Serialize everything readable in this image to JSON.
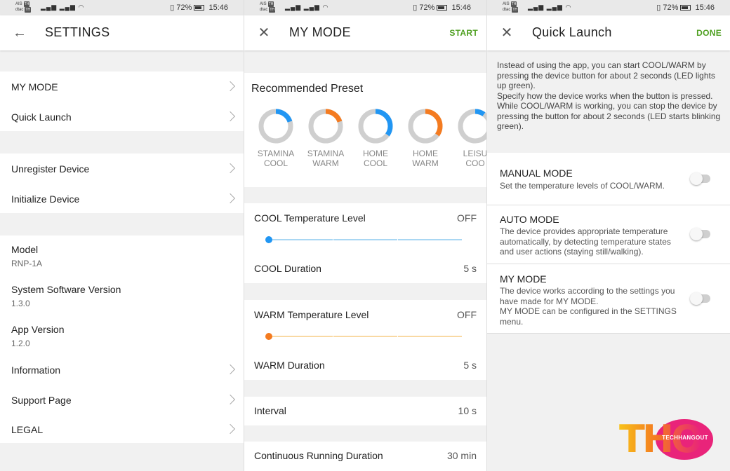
{
  "status_bar": {
    "carrier_1": "AIS",
    "carrier_2": "dtac",
    "carrier_tag": "TH",
    "battery": "72%",
    "time": "15:46"
  },
  "settings": {
    "title": "SETTINGS",
    "items": {
      "my_mode": "MY MODE",
      "quick_launch": "Quick Launch",
      "unregister": "Unregister Device",
      "initialize": "Initialize Device",
      "model_label": "Model",
      "model_value": "RNP-1A",
      "sw_label": "System Software Version",
      "sw_value": "1.3.0",
      "app_label": "App Version",
      "app_value": "1.2.0",
      "information": "Information",
      "support": "Support Page",
      "legal": "LEGAL"
    }
  },
  "my_mode": {
    "title": "MY MODE",
    "start_label": "START",
    "preset_heading": "Recommended Preset",
    "presets": [
      {
        "line1": "STAMINA",
        "line2": "COOL",
        "color": "#2196f3",
        "level": 0.2
      },
      {
        "line1": "STAMINA",
        "line2": "WARM",
        "color": "#f47b20",
        "level": 0.2
      },
      {
        "line1": "HOME",
        "line2": "COOL",
        "color": "#2196f3",
        "level": 0.35
      },
      {
        "line1": "HOME",
        "line2": "WARM",
        "color": "#f47b20",
        "level": 0.35
      },
      {
        "line1": "LEISU",
        "line2": "COO",
        "color": "#2196f3",
        "level": 0.1
      }
    ],
    "cool_level_label": "COOL Temperature Level",
    "cool_level_value": "OFF",
    "cool_duration_label": "COOL Duration",
    "cool_duration_value": "5 s",
    "warm_level_label": "WARM Temperature Level",
    "warm_level_value": "OFF",
    "warm_duration_label": "WARM Duration",
    "warm_duration_value": "5 s",
    "interval_label": "Interval",
    "interval_value": "10 s",
    "continuous_label": "Continuous Running Duration",
    "continuous_value": "30 min",
    "colors": {
      "cool": "#2196f3",
      "cool_track": "#a9d7f3",
      "warm": "#f47b20",
      "warm_track": "#f9d9a3"
    }
  },
  "quick_launch": {
    "title": "Quick Launch",
    "done_label": "DONE",
    "info": "Instead of using the app, you can start COOL/WARM by pressing the device button for about 2 seconds (LED lights up green).\n Specify how the device works when the button is pressed.\n While COOL/WARM is working, you can stop the device by pressing the button for about 2 seconds (LED starts blinking green).",
    "modes": [
      {
        "title": "MANUAL MODE",
        "desc": "Set the temperature levels of COOL/WARM."
      },
      {
        "title": "AUTO MODE",
        "desc": "The device provides appropriate temperature automatically, by detecting temperature states and user actions (staying still/walking)."
      },
      {
        "title": "MY MODE",
        "desc": "The device works according to the settings you have made for MY MODE.\nMY MODE can be configured in the SETTINGS menu."
      }
    ]
  },
  "watermark": {
    "letters": "THO",
    "brand": "TECHHANGOUT"
  }
}
